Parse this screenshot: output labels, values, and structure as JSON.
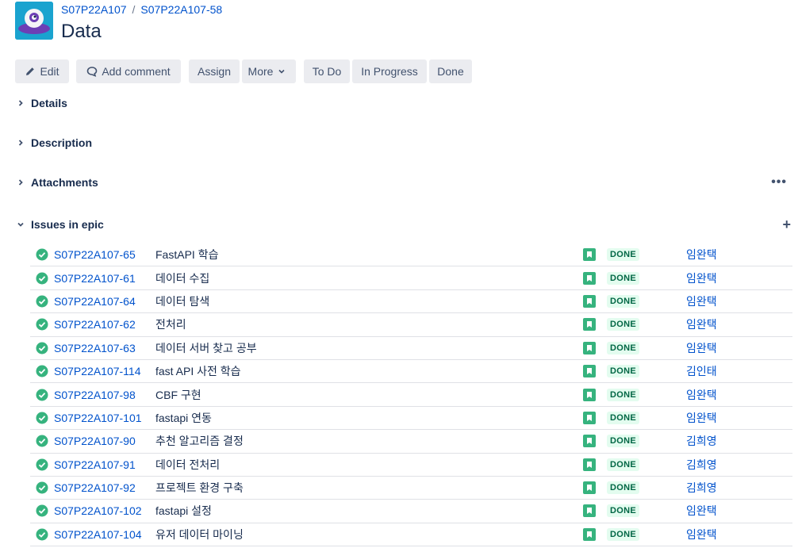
{
  "breadcrumb": {
    "project": "S07P22A107",
    "separator": "/",
    "epic": "S07P22A107-58"
  },
  "page_title": "Data",
  "toolbar": {
    "edit": "Edit",
    "add_comment": "Add comment",
    "assign": "Assign",
    "more": "More",
    "todo": "To Do",
    "in_progress": "In Progress",
    "done": "Done"
  },
  "sections": {
    "details": "Details",
    "description": "Description",
    "attachments": "Attachments",
    "issues_in_epic": "Issues in epic"
  },
  "colors": {
    "accent": "#0052cc",
    "done_bg": "#e3fcef",
    "done_text": "#006644",
    "story_green": "#36b37e",
    "check_green": "#36b37e",
    "button_bg": "#ebecf0"
  },
  "issues": [
    {
      "key": "S07P22A107-65",
      "summary": "FastAPI 학습",
      "status": "DONE",
      "assignee": "임완택"
    },
    {
      "key": "S07P22A107-61",
      "summary": "데이터 수집",
      "status": "DONE",
      "assignee": "임완택"
    },
    {
      "key": "S07P22A107-64",
      "summary": "데이터 탐색",
      "status": "DONE",
      "assignee": "임완택"
    },
    {
      "key": "S07P22A107-62",
      "summary": "전처리",
      "status": "DONE",
      "assignee": "임완택"
    },
    {
      "key": "S07P22A107-63",
      "summary": "데이터 서버 찾고 공부",
      "status": "DONE",
      "assignee": "임완택"
    },
    {
      "key": "S07P22A107-114",
      "summary": "fast API 사전 학습",
      "status": "DONE",
      "assignee": "김인태"
    },
    {
      "key": "S07P22A107-98",
      "summary": "CBF 구현",
      "status": "DONE",
      "assignee": "임완택"
    },
    {
      "key": "S07P22A107-101",
      "summary": "fastapi 연동",
      "status": "DONE",
      "assignee": "임완택"
    },
    {
      "key": "S07P22A107-90",
      "summary": "추천 알고리즘 결정",
      "status": "DONE",
      "assignee": "김희영"
    },
    {
      "key": "S07P22A107-91",
      "summary": "데이터 전처리",
      "status": "DONE",
      "assignee": "김희영"
    },
    {
      "key": "S07P22A107-92",
      "summary": "프로젝트 환경 구축",
      "status": "DONE",
      "assignee": "김희영"
    },
    {
      "key": "S07P22A107-102",
      "summary": "fastapi 설정",
      "status": "DONE",
      "assignee": "임완택"
    },
    {
      "key": "S07P22A107-104",
      "summary": "유저 데이터 마이닝",
      "status": "DONE",
      "assignee": "임완택"
    }
  ]
}
